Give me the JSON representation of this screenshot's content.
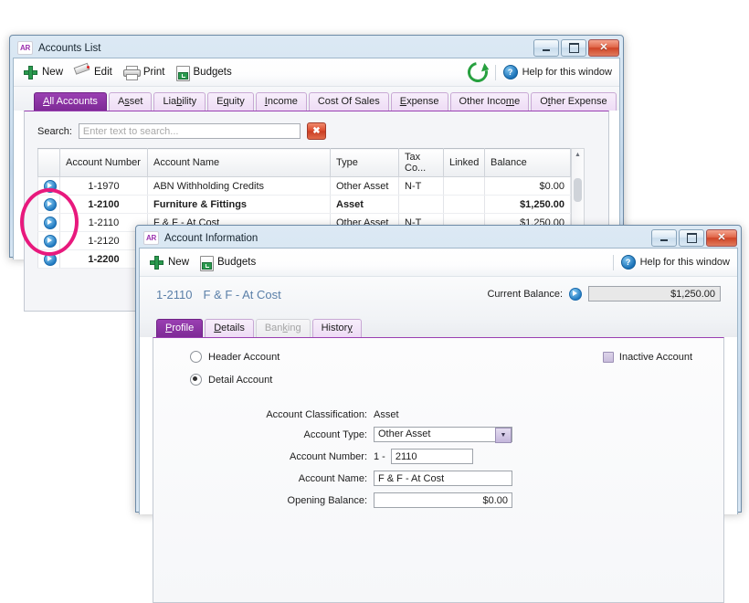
{
  "accounts_window": {
    "title": "Accounts List",
    "app_badge": "AR",
    "window_buttons": {
      "minimize": "–",
      "maximize": "□",
      "close": "✕"
    },
    "toolbar": {
      "new_label": "New",
      "edit_label": "Edit",
      "print_label": "Print",
      "budgets_label": "Budgets",
      "refresh_icon": "refresh-icon",
      "help_label": "Help for this window",
      "help_icon": "question-mark-icon"
    },
    "tabs": [
      {
        "label": "All Accounts",
        "active": true
      },
      {
        "label": "Asset",
        "active": false
      },
      {
        "label": "Liability",
        "active": false
      },
      {
        "label": "Equity",
        "active": false
      },
      {
        "label": "Income",
        "active": false
      },
      {
        "label": "Cost Of Sales",
        "active": false
      },
      {
        "label": "Expense",
        "active": false
      },
      {
        "label": "Other Income",
        "active": false
      },
      {
        "label": "Other Expense",
        "active": false
      }
    ],
    "search": {
      "label": "Search:",
      "placeholder": "Enter text to search...",
      "value": "",
      "clear_label": "✖"
    },
    "table": {
      "columns": [
        "",
        "Account Number",
        "Account Name",
        "Type",
        "Tax Co...",
        "Linked",
        "Balance"
      ],
      "rows": [
        {
          "arrow": "row-arrow-icon",
          "number": "1-1970",
          "name": "ABN Withholding Credits",
          "type": "Other Asset",
          "tax": "N-T",
          "linked": "",
          "balance": "$0.00",
          "bold": false,
          "indent": 1
        },
        {
          "arrow": "row-arrow-icon",
          "number": "1-2100",
          "name": "Furniture & Fittings",
          "type": "Asset",
          "tax": "",
          "linked": "",
          "balance": "$1,250.00",
          "bold": true,
          "indent": 0
        },
        {
          "arrow": "row-arrow-icon",
          "number": "1-2110",
          "name": "F & F  - At Cost",
          "type": "Other Asset",
          "tax": "N-T",
          "linked": "",
          "balance": "$1,250.00",
          "bold": false,
          "indent": 1
        },
        {
          "arrow": "row-arrow-icon",
          "number": "1-2120",
          "name": "",
          "type": "",
          "tax": "",
          "linked": "",
          "balance": "",
          "bold": false,
          "indent": 1
        },
        {
          "arrow": "row-arrow-icon",
          "number": "1-2200",
          "name": "",
          "type": "",
          "tax": "",
          "linked": "",
          "balance": "",
          "bold": true,
          "indent": 0
        }
      ]
    }
  },
  "account_info_window": {
    "title": "Account Information",
    "app_badge": "AR",
    "toolbar": {
      "new_label": "New",
      "budgets_label": "Budgets",
      "help_label": "Help for this window"
    },
    "account_number_title": "1-2110",
    "account_name_title": "F & F  - At Cost",
    "current_balance_label": "Current Balance:",
    "current_balance_value": "$1,250.00",
    "tabs": [
      {
        "label": "Profile",
        "active": true,
        "disabled": false
      },
      {
        "label": "Details",
        "active": false,
        "disabled": false
      },
      {
        "label": "Banking",
        "active": false,
        "disabled": true
      },
      {
        "label": "History",
        "active": false,
        "disabled": false
      }
    ],
    "header_account_label": "Header Account",
    "detail_account_label": "Detail Account",
    "account_mode": "detail",
    "inactive_label": "Inactive Account",
    "inactive_checked": false,
    "fields": {
      "classification_label": "Account Classification:",
      "classification_value": "Asset",
      "type_label": "Account Type:",
      "type_value": "Other Asset",
      "number_label": "Account Number:",
      "number_prefix": "1 -",
      "number_value": "2110",
      "name_label": "Account Name:",
      "name_value": "F & F  - At Cost",
      "opening_balance_label": "Opening Balance:",
      "opening_balance_value": "$0.00"
    }
  },
  "annotation": {
    "shape": "ellipse",
    "color": "#e8197d"
  }
}
